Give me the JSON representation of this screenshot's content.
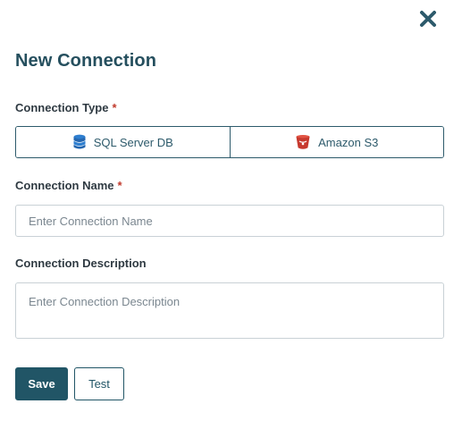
{
  "dialog": {
    "title": "New Connection",
    "close_icon": "close-icon",
    "accent_color": "#215566"
  },
  "connection_type": {
    "label": "Connection Type",
    "required_marker": "*",
    "options": [
      {
        "label": "SQL Server DB",
        "icon": "database-icon"
      },
      {
        "label": "Amazon S3",
        "icon": "bucket-icon"
      }
    ]
  },
  "connection_name": {
    "label": "Connection Name",
    "required_marker": "*",
    "placeholder": "Enter Connection Name",
    "value": ""
  },
  "connection_description": {
    "label": "Connection Description",
    "placeholder": "Enter Connection Description",
    "value": ""
  },
  "actions": {
    "save_label": "Save",
    "test_label": "Test"
  }
}
